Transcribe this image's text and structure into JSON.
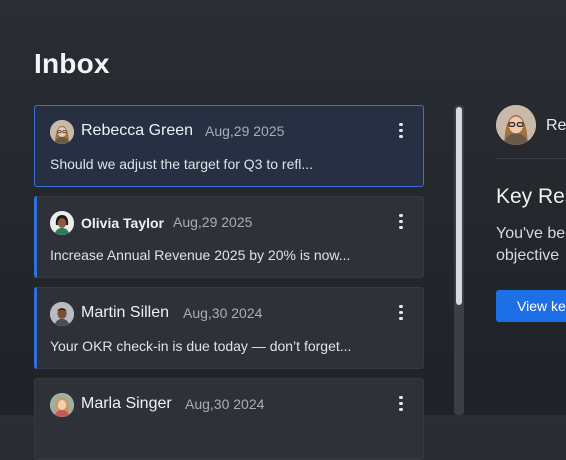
{
  "page": {
    "title": "Inbox"
  },
  "messages": [
    {
      "name": "Rebecca Green",
      "date": "Aug,29 2025",
      "preview": "Should we adjust the target for Q3 to refl..."
    },
    {
      "name": "Olivia Taylor",
      "date": "Aug,29 2025",
      "preview": "Increase Annual Revenue 2025 by 20% is now..."
    },
    {
      "name": "Martin Sillen",
      "date": "Aug,30 2024",
      "preview": "Your OKR check-in is due today — don’t forget..."
    },
    {
      "name": "Marla Singer",
      "date": "Aug,30 2024",
      "preview": ""
    }
  ],
  "detail": {
    "name": "Re",
    "heading": "Key Res",
    "body_line1": "You've be",
    "body_line2": "objective",
    "button_label": "View ke"
  },
  "colors": {
    "accent": "#2f6fe0",
    "selected_border": "#3a6fd8",
    "button": "#1d6fe6"
  },
  "icons": {
    "kebab": "more-vertical-icon"
  }
}
